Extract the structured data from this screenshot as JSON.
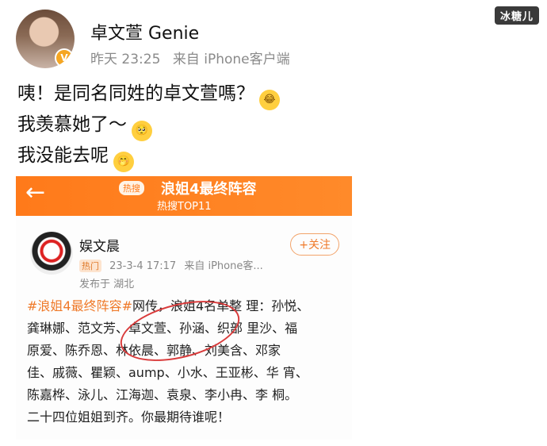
{
  "watermark": "冰糖儿",
  "post": {
    "username": "卓文萱 Genie",
    "time": "昨天 23:25",
    "source": "来自 iPhone客户端",
    "lines": [
      {
        "text": "咦！是同名同姓的卓文萱嗎？",
        "emoji": "laugh-cry-emoji"
      },
      {
        "text": "我羡慕她了～",
        "emoji": "pleading-emoji"
      },
      {
        "text": "我没能去呢",
        "emoji": "sad-emoji"
      }
    ]
  },
  "embedded": {
    "hot_tag": "热搜",
    "topic": "浪姐4最终阵容",
    "rank": "热搜TOP11",
    "op_name": "娱文晨",
    "follow_label": "+关注",
    "badge": "热门",
    "op_time": "23-3-4 17:17",
    "op_source": "来自 iPhone客...",
    "location": "发布于 湖北",
    "body_hashtag": "#浪姐4最终阵容#",
    "body_lines": [
      "网传，浪姐4名单整 理：孙悦、",
      "龚琳娜、范文芳、卓文萱、孙涵、织部 里沙、福",
      "原爱、陈乔恩、林依晨、郭静、刘美含、邓家",
      "佳、戚薇、瞿颖、aump、小水、王亚彬、华 宵、",
      "陈嘉桦、泳儿、江海迦、袁泉、李小冉、李 桐。",
      "二十四位姐姐到齐。你最期待谁呢！"
    ]
  }
}
